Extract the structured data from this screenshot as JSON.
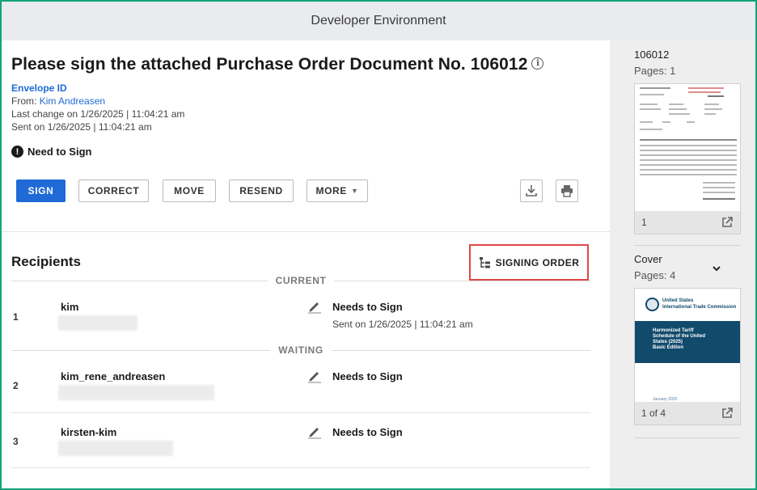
{
  "app": {
    "environment_banner": "Developer Environment"
  },
  "envelope": {
    "title": "Please sign the attached Purchase Order Document No. 106012",
    "envelope_id_label": "Envelope ID",
    "from_label": "From:",
    "from_name": "Kim Andreasen",
    "last_change": "Last change on 1/26/2025 | 11:04:21 am",
    "sent": "Sent on 1/26/2025 | 11:04:21 am",
    "status": "Need to Sign"
  },
  "actions": {
    "sign": "SIGN",
    "correct": "CORRECT",
    "move": "MOVE",
    "resend": "RESEND",
    "more": "MORE"
  },
  "recipients": {
    "heading": "Recipients",
    "signing_order_label": "SIGNING ORDER",
    "groups": {
      "current": "CURRENT",
      "waiting": "WAITING"
    },
    "items": [
      {
        "order": "1",
        "name": "kim",
        "status": "Needs to Sign",
        "sent": "Sent on 1/26/2025 | 11:04:21 am"
      },
      {
        "order": "2",
        "name": "kim_rene_andreasen",
        "status": "Needs to Sign"
      },
      {
        "order": "3",
        "name": "kirsten-kim",
        "status": "Needs to Sign"
      }
    ]
  },
  "documents": [
    {
      "title": "106012",
      "pages": "Pages: 1",
      "footer": "1"
    },
    {
      "title": "Cover",
      "pages": "Pages: 4",
      "footer": "1 of 4",
      "thumb_header_line1": "United States",
      "thumb_header_line2": "International Trade Commission",
      "thumb_band": [
        "Harmonized Tariff",
        "Schedule of the United",
        "States (2025)",
        "Basic Edition"
      ],
      "thumb_date": "January 2025"
    }
  ],
  "colors": {
    "accent": "#1f6ad6",
    "frame": "#12a37a",
    "highlight": "#e04848",
    "cover_band": "#114a6b"
  },
  "icons": [
    "info-icon",
    "alert-icon",
    "download-icon",
    "print-icon",
    "signing-order-icon",
    "pen-icon",
    "chevron-down-icon",
    "open-external-icon"
  ]
}
